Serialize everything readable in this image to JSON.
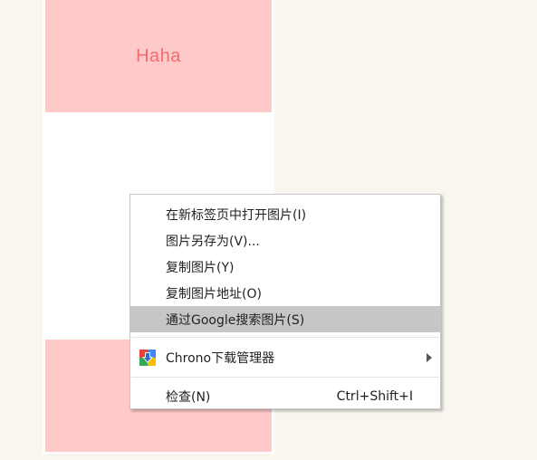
{
  "page": {
    "tile_top_text": "Haha"
  },
  "context_menu": {
    "items": [
      {
        "label": "在新标签页中打开图片(I)"
      },
      {
        "label": "图片另存为(V)..."
      },
      {
        "label": "复制图片(Y)"
      },
      {
        "label": "复制图片地址(O)"
      },
      {
        "label": "通过Google搜索图片(S)",
        "highlighted": true
      }
    ],
    "extension_item": {
      "label": "Chrono下载管理器",
      "icon": "chrono-extension-icon",
      "has_submenu": true
    },
    "inspect_item": {
      "label": "检查(N)",
      "shortcut": "Ctrl+Shift+I"
    }
  },
  "colors": {
    "page_background": "#f8f6ef",
    "tile_background": "#fec9c9",
    "tile_text": "#f46c6c",
    "highlight": "#c6c6c6"
  }
}
